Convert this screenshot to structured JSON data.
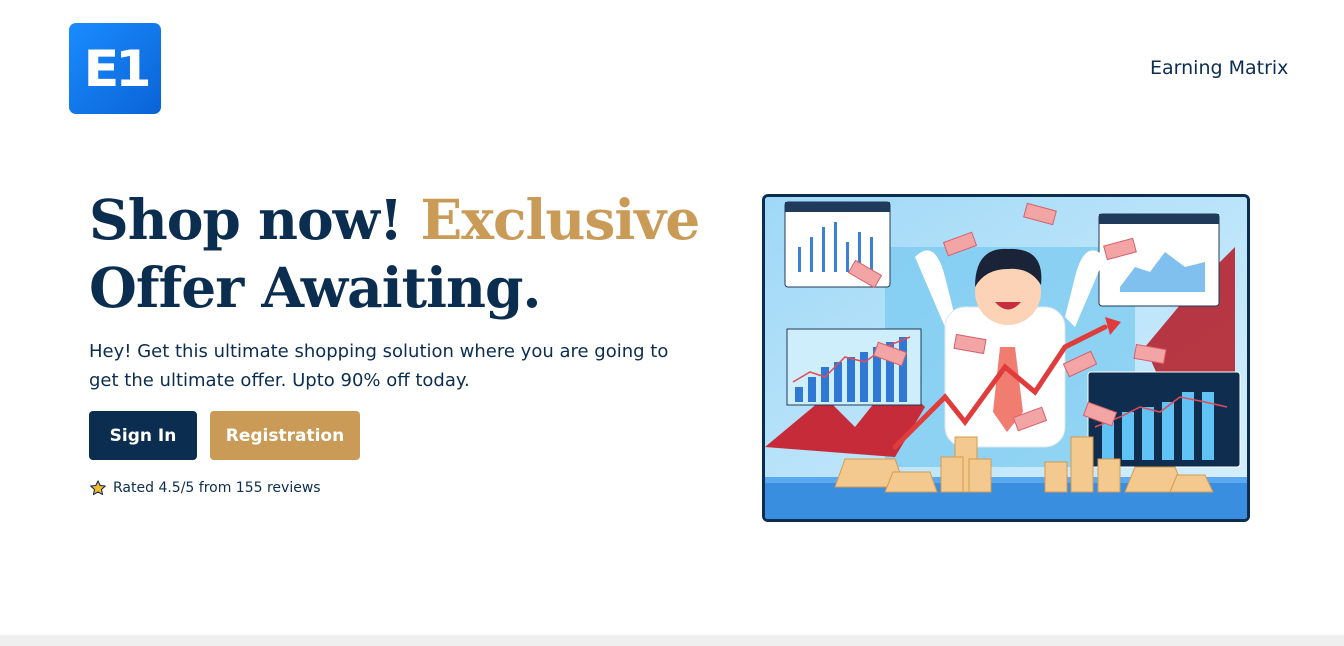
{
  "logo": {
    "text": "E1",
    "color_from": "#1a8cff",
    "color_to": "#0a63d6"
  },
  "header": {
    "brand": "Earning Matrix"
  },
  "hero": {
    "headline_part1": "Shop now! ",
    "headline_accent": "Exclusive",
    "headline_part2": "Offer Awaiting.",
    "subtext": "Hey! Get this ultimate shopping solution where you are going to get the ultimate offer. Upto 90% off today.",
    "signin_label": "Sign In",
    "register_label": "Registration",
    "rating_text": "Rated 4.5/5 from 155 reviews",
    "rating_icon": "star-icon"
  },
  "colors": {
    "primary": "#0b2d4f",
    "accent": "#c99b57",
    "background": "#ffffff"
  },
  "illustration": {
    "icon": "business-man-celebrating-charts-illustration"
  }
}
